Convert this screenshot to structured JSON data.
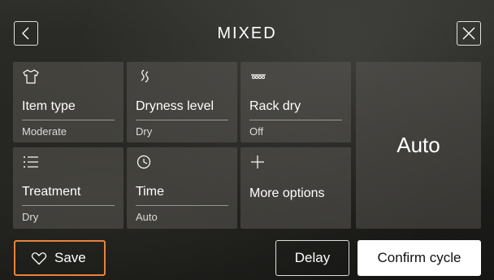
{
  "header": {
    "title": "MIXED",
    "back_icon": "chevron-left-icon",
    "close_icon": "close-icon"
  },
  "tiles": [
    {
      "label": "Item type",
      "value": "Moderate",
      "icon": "shirt-icon"
    },
    {
      "label": "Dryness level",
      "value": "Dry",
      "icon": "heat-wave-icon"
    },
    {
      "label": "Rack dry",
      "value": "Off",
      "icon": "rack-icon"
    },
    {
      "label": "Treatment",
      "value": "Dry",
      "icon": "list-icon"
    },
    {
      "label": "Time",
      "value": "Auto",
      "icon": "clock-icon"
    },
    {
      "label": "More options",
      "value": "",
      "icon": "plus-icon"
    }
  ],
  "summary": {
    "value": "Auto"
  },
  "footer": {
    "save_label": "Save",
    "delay_label": "Delay",
    "confirm_label": "Confirm cycle"
  },
  "colors": {
    "accent": "#e8833a",
    "confirm_bg": "#ffffff"
  }
}
